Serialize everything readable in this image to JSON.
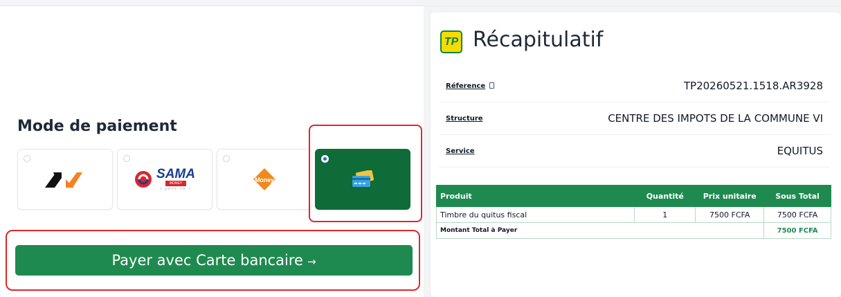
{
  "payment": {
    "title": "Mode de paiement",
    "methods": [
      {
        "name": "wave-style-logo",
        "selected": false
      },
      {
        "name": "sama-money",
        "word": "SAMA",
        "sub": "MONEY",
        "tagline": "i yèrè ta !",
        "selected": false
      },
      {
        "name": "orange-money",
        "text": "Money",
        "selected": false
      },
      {
        "name": "credit-card",
        "selected": true
      }
    ],
    "button_label": "Payer avec Carte bancaire",
    "button_arrow": "→"
  },
  "recap": {
    "logo_text": "TP",
    "title": "Récapitulatif",
    "rows": [
      {
        "label": "Réference",
        "value": "TP20260521.1518.AR3928"
      },
      {
        "label": "Structure",
        "value": "CENTRE DES IMPOTS DE LA COMMUNE VI"
      },
      {
        "label": "Service",
        "value": "EQUITUS"
      }
    ],
    "table": {
      "headers": [
        "Produit",
        "Quantité",
        "Prix unitaire",
        "Sous Total"
      ],
      "rows": [
        [
          "Timbre du quitus fiscal",
          "1",
          "7500 FCFA",
          "7500 FCFA"
        ]
      ],
      "total_label": "Montant Total à Payer",
      "total_value": "7500 FCFA"
    }
  },
  "colors": {
    "primary_green": "#1e8a4f",
    "selected_card": "#0f6b37",
    "highlight_red": "#e0262b",
    "logo_yellow": "#f4dd00"
  }
}
